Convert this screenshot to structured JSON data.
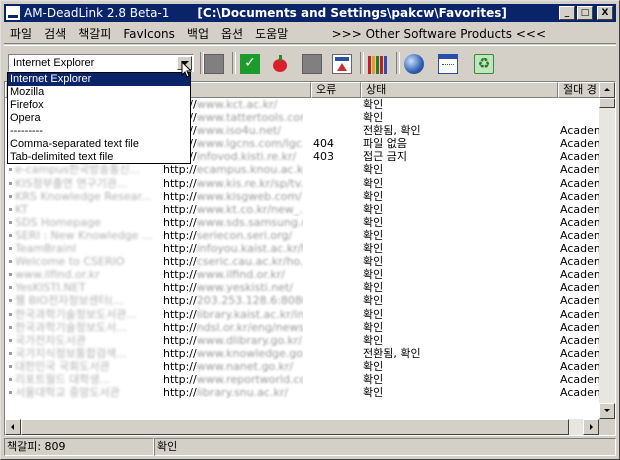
{
  "window": {
    "title": "AM-DeadLink 2.8 Beta-1",
    "path": "[C:\\Documents and Settings\\pakcw\\Favorites]",
    "minimize_label": "_",
    "maximize_label": "□",
    "close_label": "X"
  },
  "menu": {
    "items": [
      "파일",
      "검색",
      "책갈피",
      "FavIcons",
      "백업",
      "옵션",
      "도움말"
    ],
    "right_link": ">>> Other Software Products <<<"
  },
  "toolbar": {
    "browser_value": "Internet Explorer",
    "check_glyph": "✓",
    "recycle_glyph": "♻"
  },
  "dropdown": {
    "options": [
      "Internet Explorer",
      "Mozilla",
      "Firefox",
      "Opera",
      "---------",
      "Comma-separated text file",
      "Tab-delimited text file"
    ],
    "selected_index": 0
  },
  "columns": [
    "",
    "",
    "오류",
    "상태",
    "절대 경"
  ],
  "rows": [
    {
      "title": "",
      "url_pre": "http://",
      "url_host": "www.kct.ac.kr/",
      "error": "",
      "status": "확인",
      "category": ""
    },
    {
      "title": "",
      "url_pre": "http://",
      "url_host": "www.tattertools.com/",
      "error": "",
      "status": "확인",
      "category": ""
    },
    {
      "title": "",
      "url_pre": "http://",
      "url_host": "www.iso4u.net/",
      "error": "",
      "status": "전환됨, 확인",
      "category": "Academ"
    },
    {
      "title": "",
      "url_pre": "http://",
      "url_host": "www.lgcns.com/lgc...",
      "error": "404",
      "status": "파일 없음",
      "category": "Academ"
    },
    {
      "title": "",
      "url_pre": "http://",
      "url_host": "infovod.kisti.re.kr/",
      "error": "403",
      "status": "접근 금지",
      "category": "Academ"
    },
    {
      "title": "e-campus한국방송통신...",
      "url_pre": "http://",
      "url_host": "ecampus.knou.ac.kr/",
      "error": "",
      "status": "확인",
      "category": "Academ"
    },
    {
      "title": "KIS정부출연 연구기관...",
      "url_pre": "http://",
      "url_host": "www.kis.re.kr/sp/tv...",
      "error": "",
      "status": "확인",
      "category": "Academ"
    },
    {
      "title": "KRS Knowledge Resear...",
      "url_pre": "http://",
      "url_host": "www.kisgweb.com/",
      "error": "",
      "status": "확인",
      "category": "Academ"
    },
    {
      "title": "KT",
      "url_pre": "http://",
      "url_host": "www.kt.co.kr/new_...",
      "error": "",
      "status": "확인",
      "category": "Academ"
    },
    {
      "title": "SDS Homepage",
      "url_pre": "http://",
      "url_host": "www.sds.samsung.c...",
      "error": "",
      "status": "확인",
      "category": "Academ"
    },
    {
      "title": "SERI : New Knowledge ...",
      "url_pre": "http://",
      "url_host": "seriecon.seri.org/",
      "error": "",
      "status": "확인",
      "category": "Academ"
    },
    {
      "title": "TeamBrainI",
      "url_pre": "http://",
      "url_host": "infoyou.kaist.ac.kr/M...",
      "error": "",
      "status": "확인",
      "category": "Academ"
    },
    {
      "title": "Welcome to CSERIO",
      "url_pre": "http://",
      "url_host": "cseric.cau.ac.kr/ho...",
      "error": "",
      "status": "확인",
      "category": "Academ"
    },
    {
      "title": "www.ilfind.or.kr",
      "url_pre": "http://",
      "url_host": "www.ilfind.or.kr/",
      "error": "",
      "status": "확인",
      "category": "Academ"
    },
    {
      "title": "YesKISTI.NET",
      "url_pre": "http://",
      "url_host": "www.yeskisti.net/",
      "error": "",
      "status": "확인",
      "category": "Academ"
    },
    {
      "title": "웰 BIO전자정보센터(...",
      "url_pre": "http://",
      "url_host": "203.253.128.6:8080...",
      "error": "",
      "status": "확인",
      "category": "Academ"
    },
    {
      "title": "한국과학기술정보도서관...",
      "url_pre": "http://",
      "url_host": "library.kaist.ac.kr/ind...",
      "error": "",
      "status": "확인",
      "category": "Academ"
    },
    {
      "title": "한국과학기술정보도서...",
      "url_pre": "http://",
      "url_host": "ndsl.or.kr/eng/news...",
      "error": "",
      "status": "확인",
      "category": "Academ"
    },
    {
      "title": "국가전자도서관",
      "url_pre": "http://",
      "url_host": "www.dlibrary.go.kr/",
      "error": "",
      "status": "확인",
      "category": "Academ"
    },
    {
      "title": "국가지식정보통합검색...",
      "url_pre": "http://",
      "url_host": "www.knowledge.go...",
      "error": "",
      "status": "전환됨, 확인",
      "category": "Academ"
    },
    {
      "title": "대한민국 국회도서관",
      "url_pre": "http://",
      "url_host": "www.nanet.go.kr/",
      "error": "",
      "status": "확인",
      "category": "Academ"
    },
    {
      "title": "리포트월드 대학생...",
      "url_pre": "http://",
      "url_host": "www.reportworld.co...",
      "error": "",
      "status": "확인",
      "category": "Academ"
    },
    {
      "title": "서울대학교 중앙도서관",
      "url_pre": "http://",
      "url_host": "library.snu.ac.kr/",
      "error": "",
      "status": "확인",
      "category": "Academ"
    }
  ],
  "status": {
    "count_label": "책갈피: 809",
    "state_label": "확인"
  }
}
